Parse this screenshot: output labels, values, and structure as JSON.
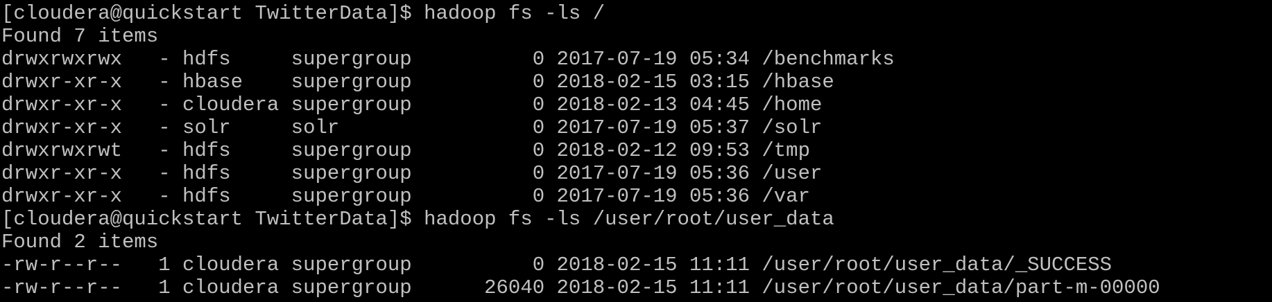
{
  "terminal": {
    "prompt": "[cloudera@quickstart TwitterData]$ ",
    "colors": {
      "background": "#000000",
      "foreground": "#c0c0c0"
    },
    "lines": [
      "[cloudera@quickstart TwitterData]$ hadoop fs -ls /",
      "Found 7 items",
      "drwxrwxrwx   - hdfs     supergroup          0 2017-07-19 05:34 /benchmarks",
      "drwxr-xr-x   - hbase    supergroup          0 2018-02-15 03:15 /hbase",
      "drwxr-xr-x   - cloudera supergroup          0 2018-02-13 04:45 /home",
      "drwxr-xr-x   - solr     solr                0 2017-07-19 05:37 /solr",
      "drwxrwxrwt   - hdfs     supergroup          0 2018-02-12 09:53 /tmp",
      "drwxr-xr-x   - hdfs     supergroup          0 2017-07-19 05:36 /user",
      "drwxr-xr-x   - hdfs     supergroup          0 2017-07-19 05:36 /var",
      "[cloudera@quickstart TwitterData]$ hadoop fs -ls /user/root/user_data",
      "Found 2 items",
      "-rw-r--r--   1 cloudera supergroup          0 2018-02-15 11:11 /user/root/user_data/_SUCCESS",
      "-rw-r--r--   1 cloudera supergroup      26040 2018-02-15 11:11 /user/root/user_data/part-m-00000"
    ]
  }
}
